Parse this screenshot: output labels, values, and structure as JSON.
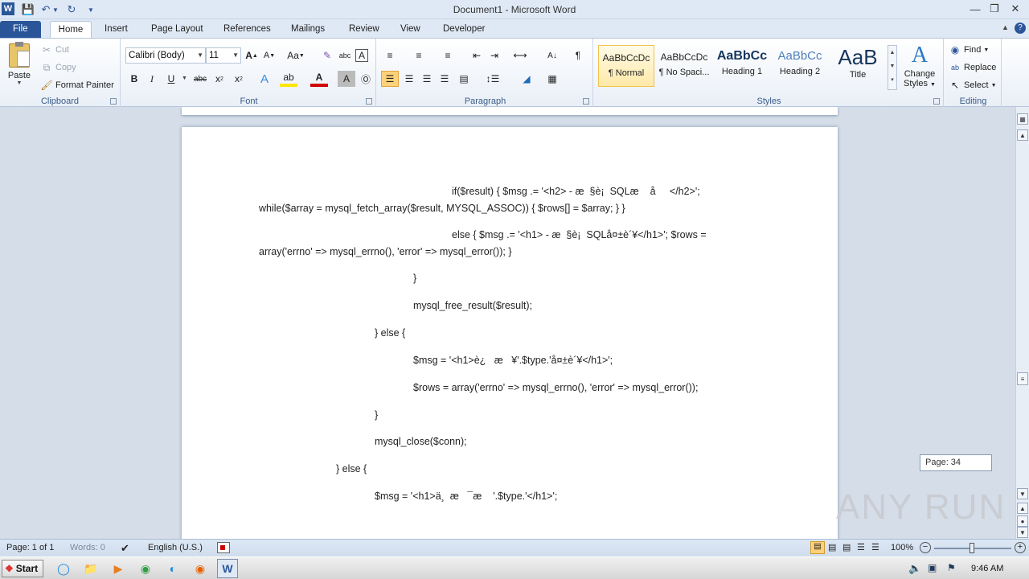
{
  "window": {
    "title": "Document1 - Microsoft Word",
    "app_icon": "W"
  },
  "tabs": [
    {
      "label": "File"
    },
    {
      "label": "Home"
    },
    {
      "label": "Insert"
    },
    {
      "label": "Page Layout"
    },
    {
      "label": "References"
    },
    {
      "label": "Mailings"
    },
    {
      "label": "Review"
    },
    {
      "label": "View"
    },
    {
      "label": "Developer"
    }
  ],
  "clipboard": {
    "paste": "Paste",
    "cut": "Cut",
    "copy": "Copy",
    "format_painter": "Format Painter",
    "label": "Clipboard"
  },
  "font": {
    "name": "Calibri (Body)",
    "size": "11",
    "label": "Font"
  },
  "paragraph": {
    "label": "Paragraph"
  },
  "styles": {
    "label": "Styles",
    "items": [
      {
        "sample": "AaBbCcDc",
        "name": "¶ Normal"
      },
      {
        "sample": "AaBbCcDc",
        "name": "¶ No Spaci..."
      },
      {
        "sample": "AaBbCc",
        "name": "Heading 1"
      },
      {
        "sample": "AaBbCc",
        "name": "Heading 2"
      },
      {
        "sample": "AaB",
        "name": "Title"
      }
    ],
    "change_styles_1": "Change",
    "change_styles_2": "Styles"
  },
  "editing": {
    "find": "Find",
    "replace": "Replace",
    "select": "Select",
    "label": "Editing"
  },
  "document": {
    "lines": [
      "if($result) { $msg .= '<h2> - æ  §è¡  SQLæ    å     </h2>';",
      "while($array = mysql_fetch_array($result, MYSQL_ASSOC)) { $rows[] = $array; } }",
      "else { $msg .= '<h1> - æ  §è¡  SQLå¤±è´¥</h1>'; $rows =",
      "array('errno' => mysql_errno(), 'error' => mysql_error()); }",
      "}",
      "mysql_free_result($result);",
      "} else {",
      "$msg = '<h1>è¿   æ   ¥'.$type.'å¤±è´¥</h1>';",
      "$rows = array('errno' => mysql_errno(), 'error' => mysql_error());",
      "}",
      "mysql_close($conn);",
      "} else {",
      "$msg = '<h1>ä¸  æ   ¯æ    '.$type.'</h1>';"
    ]
  },
  "page_tip": "Page: 34",
  "status": {
    "page": "Page: 1 of 1",
    "words": "Words: 0",
    "language": "English (U.S.)",
    "zoom": "100%"
  },
  "taskbar": {
    "start": "Start",
    "time": "9:46 AM"
  },
  "watermark": "ANY RUN"
}
